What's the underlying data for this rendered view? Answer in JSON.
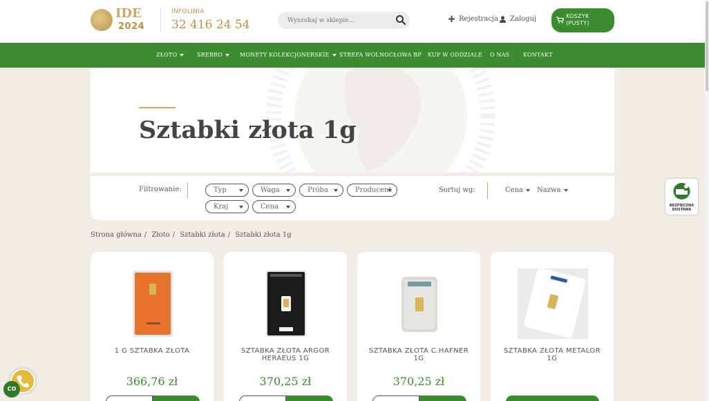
{
  "header": {
    "logo_text": "IDE",
    "logo_year": "2024",
    "infolinia_label": "INFOLINIA",
    "infolinia_phone": "32 416 24 54",
    "search_placeholder": "Wyszukaj w sklepie...",
    "register_label": "Rejestracja",
    "login_label": "Zaloguj",
    "cart_line1": "KOSZYK",
    "cart_line2": "(PUSTY)"
  },
  "nav": {
    "items": [
      {
        "label": "ZŁOTO",
        "dropdown": true
      },
      {
        "label": "SREBRO",
        "dropdown": true
      },
      {
        "label": "MONETY KOLEKCJONERSKIE",
        "dropdown": true
      },
      {
        "label": "STREFA WOLNOCŁOWA BP",
        "dropdown": false
      },
      {
        "label": "KUP W ODDZIALE",
        "dropdown": false
      },
      {
        "label": "O NAS",
        "dropdown": false
      },
      {
        "label": "KONTAKT",
        "dropdown": false
      }
    ]
  },
  "hero": {
    "title": "Sztabki złota 1g"
  },
  "filters": {
    "label": "Filtrowanie:",
    "pills": [
      "Typ",
      "Waga",
      "Próba",
      "Producent",
      "Kraj",
      "Cena"
    ],
    "sort_label": "Sortuj wg:",
    "sort_options": [
      "Cena",
      "Nazwa"
    ]
  },
  "breadcrumb": [
    "Strona główna",
    "Złoto",
    "Sztabki złota",
    "Sztabki złota 1g"
  ],
  "products": [
    {
      "name": "1 G SZTABKA ZŁOTA",
      "price": "366,76 zł",
      "image": "valcambi-orange-card",
      "has_cart": true
    },
    {
      "name": "SZTABKA ZŁOTA ARGOR HERAEUS 1G",
      "price": "370,25 zł",
      "image": "argor-black-card",
      "has_cart": true
    },
    {
      "name": "SZTABKA ZŁOTA C.HAFNER 1G",
      "price": "370,25 zł",
      "image": "hafner-grey-card",
      "has_cart": true
    },
    {
      "name": "SZTABKA ZŁOTA METALOR 1G",
      "price": "",
      "image": "metalor-white-card",
      "has_cart": false
    }
  ],
  "badge": {
    "line1": "BEZPIECZNA",
    "line2": "DOSTAWA"
  },
  "floating": {
    "co_label": "CO"
  },
  "colors": {
    "brand_green": "#3a8c2e",
    "gold": "#c9a867",
    "background": "#f1ede6"
  }
}
